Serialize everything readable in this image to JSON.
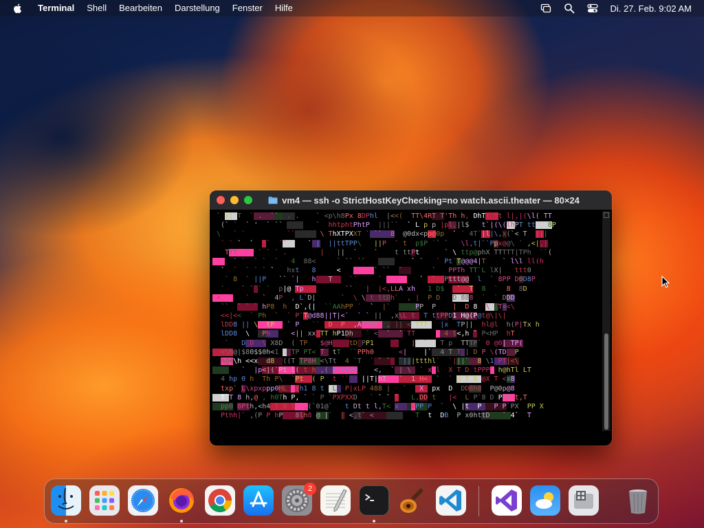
{
  "menubar": {
    "app_name": "Terminal",
    "items": [
      "Shell",
      "Bearbeiten",
      "Darstellung",
      "Fenster",
      "Hilfe"
    ],
    "clock": "Di. 27. Feb.  9:02 AM",
    "status_icons": [
      "screen-mirroring-icon",
      "search-icon",
      "control-center-icon"
    ]
  },
  "window": {
    "title": "vm4 — ssh -o StrictHostKeyChecking=no watch.ascii.theater — 80×24",
    "screen_lines": [
      " ` x| T  ` .  ``  . .    ` <p\\h8Px 8DPhl  |<<(  TT\\4RT T'Th h, DhTt Tt l|,|(\\l( TT",
      "  (` `  ` '  ` ``        `  hhtphtPhtP  |||``  ` L p p |pl,|l$   t`|(\\(lhPT tt   8P",
      " \\   ` `          ``      \\ ThXTPXXT ` ``  8  @0dx<pp@0p  ` ` 4T`|l|\\,x(`< T  |||",
      "  ` ` `  `  ``  ``     ` |  ||ttTPP\\   ||P  ` t  p$P `` `   \\l,t|``Ppx@@\\ ` ,<|,|",
      "   TTT  `  ` ` ` .        |   ||  `    `    t ttPt      ` \\ ttp@phX TTTTT|TPh  ``(",
      "  `  ` `  ` `  `   4  88<     ` `` ``           ` `   ` Pt`T@@@4|T    ` l\\l ll(h",
      "  `  `  ` ` ` `   hxt   8     <     ` `` ``  `       `   PPTh TT`L lX|   ttt0",
      "   ` 8  ` ||P   `` `|   h   T    ``     ` `       `  `  Pttt@@  l  ` 8PP D0D8P",
      "  `    ` ` ` `  p|@ Tp          ``   |  |<,LLA xh   1 D$   `  T  8  `  8  8D",
      " <  `   `   `  4P  , L`D|      `  \\ \\ t ttDh`  , |  P D   D 888  `  ` DDD",
      "  ``  ` ` ` hP8  h  D`,(|  ``AAhPP `  `  |`      PP  P    |  D 8  \\ |T<<\\ ",
      "  <<|<<  ` Ph  `  ` P`T@d88||T|<`  ` ` ||  ,x\\L t  T ttPPD1 H@(P@t@\\|\\|",
      "  lDD8 || \\  tP   ` P   ``  D  P  ,ATTTP  , || < TTT   |x  TP||  hl@l  h(P|Tx h",
      "  lDD8  \\   Ph     <|| xx TT hP1Dh   ` <  `  ``TT       4 t<,h ` P<HP  hT",
      "   `   D D  \\ X8D  ( TP   $@H    tD PP1     `   |` `   T p  TTTP` 0 @0| TP(",
      "  <\\h@|$80$$0h<1 \\ TP PT< T  tT  ``PPh0      <|    |`  4 T T | D P \\(TD  P",
      "  h@4\\h <<x  d8  ((T TP8H <\\Tt  4 `T  ` ` `  `|||ttthl`  `|||`  8 \\1 PT|<\\",
      "       `  |p<|(`Pt l( t h ,( XLxx<<    <,  ` | \\  ` x l  X T D tPPP  h@hTl LT",
      "  4 hp 0 h  Th P\\  `Pt  ( P  t ``   ||T|hT   `  1 H<  `  ` @ T 8 @X T <x8",
      "  txp` L\\xpxppp0HL  (h1 8 t  L  P|xLP 488 |   `   X  px  D  DD8h8  P@0p@8",
      "  T`T 8 h,@ , h0Th P, ` ` P `PXPXXD   ` ` ` `   L,DD t   |<  L P`8 D PPT t,T",
      "  pp0 8Pth,<h4 t 8 t  ,(`01@`   t Dt t l,T< x   DPP P  `  \\ |t  P   P P`PX  PP X",
      "  Pthh|` ,(P P hP   8lh8 @ |`  | <,t` <          T  t  DB  P x0httD   ` 4`  T"
    ]
  },
  "dock": {
    "apps": [
      {
        "name": "Finder",
        "icon": "finder-icon",
        "running": true
      },
      {
        "name": "Launchpad",
        "icon": "launchpad-icon",
        "running": false
      },
      {
        "name": "Safari",
        "icon": "safari-icon",
        "running": false
      },
      {
        "name": "Firefox",
        "icon": "firefox-icon",
        "running": true
      },
      {
        "name": "Google Chrome",
        "icon": "chrome-icon",
        "running": false
      },
      {
        "name": "App Store",
        "icon": "app-store-icon",
        "running": false
      },
      {
        "name": "Systemeinstellungen",
        "icon": "system-settings-icon",
        "running": false,
        "badge": "2"
      },
      {
        "name": "TextEdit",
        "icon": "textedit-icon",
        "running": false
      },
      {
        "name": "Terminal",
        "icon": "terminal-icon",
        "running": true
      },
      {
        "name": "GarageBand",
        "icon": "garageband-icon",
        "running": false
      },
      {
        "name": "Visual Studio Code",
        "icon": "vscode-icon",
        "running": false
      },
      {
        "name": "Visual Studio",
        "icon": "visual-studio-icon",
        "running": false
      },
      {
        "name": "Wetter",
        "icon": "weather-icon",
        "running": false
      },
      {
        "name": "Boot Camp",
        "icon": "disk-utility-icon",
        "running": false
      },
      {
        "name": "Papierkorb",
        "icon": "trash-icon",
        "running": false
      }
    ]
  },
  "colors": {
    "terminal_bg": "#000000",
    "titlebar": "#2b2b2d",
    "accent_red": "#ff5f57",
    "accent_yellow": "#febc2e",
    "accent_green": "#28c840",
    "badge": "#ff3b30"
  }
}
